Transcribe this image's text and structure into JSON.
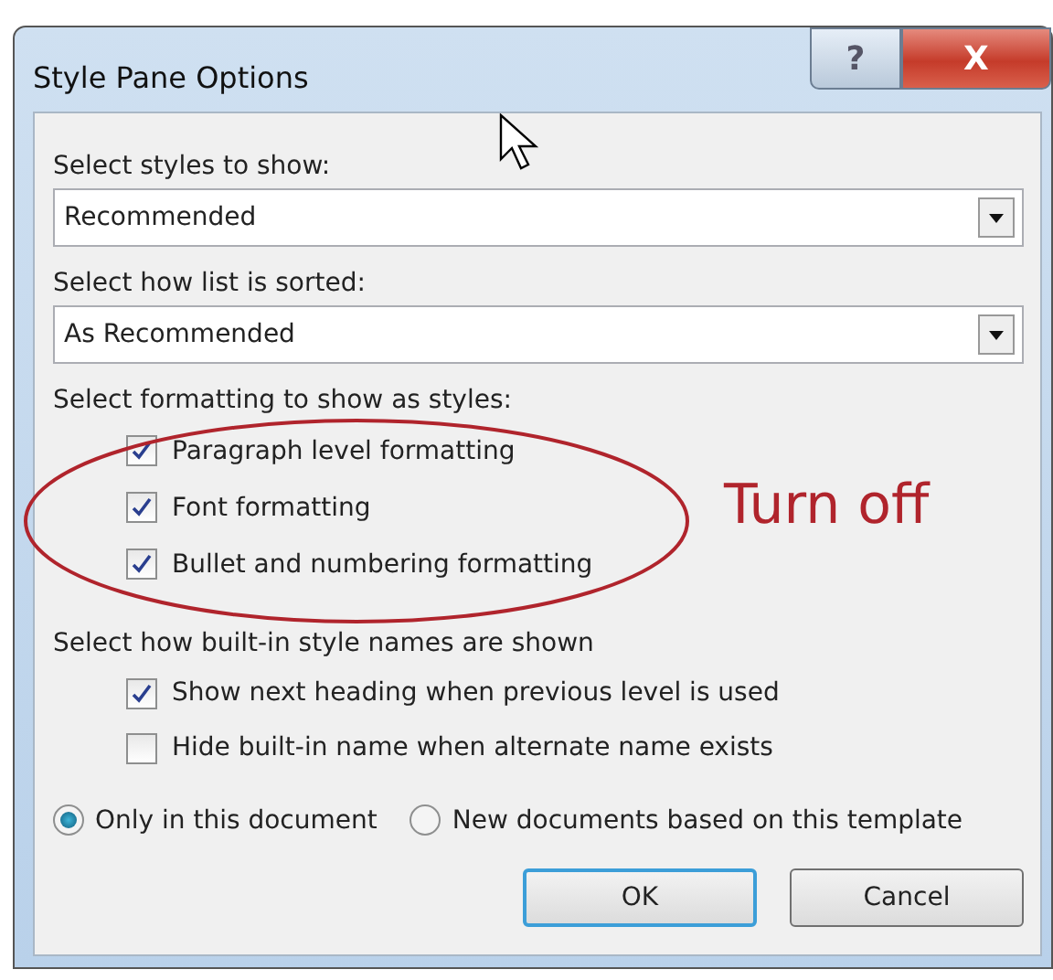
{
  "window": {
    "title": "Style Pane Options"
  },
  "title_buttons": [
    {
      "kind": "help",
      "label": "?"
    },
    {
      "kind": "close",
      "label": "X"
    }
  ],
  "styles_to_show": {
    "label": "Select styles to show:",
    "value": "Recommended"
  },
  "sort_order": {
    "label": "Select how list is sorted:",
    "value": "As Recommended"
  },
  "formatting": {
    "label": "Select formatting to show as styles:",
    "options": [
      {
        "label": "Paragraph level formatting",
        "checked": true
      },
      {
        "label": "Font formatting",
        "checked": true
      },
      {
        "label": "Bullet and numbering formatting",
        "checked": true
      }
    ]
  },
  "builtin_names": {
    "label": "Select how built-in style names are shown",
    "options": [
      {
        "label": "Show next heading when previous level is used",
        "checked": true
      },
      {
        "label": "Hide built-in name when alternate name exists",
        "checked": false
      }
    ]
  },
  "scope": [
    {
      "label": "Only in this document",
      "selected": true
    },
    {
      "label": "New documents based on this template",
      "selected": false
    }
  ],
  "buttons": [
    {
      "label": "OK",
      "default": true
    },
    {
      "label": "Cancel",
      "default": false
    }
  ],
  "annotation": {
    "text": "Turn off"
  }
}
